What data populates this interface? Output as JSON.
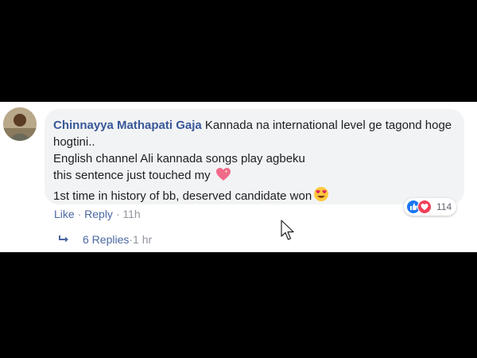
{
  "comment": {
    "author": "Chinnayya Mathapati Gaja",
    "lines": [
      "Kannada na international level ge tagond hoge hogtini..",
      "English channel Ali kannada songs play agbeku",
      "this sentence just touched my",
      "1st time in history of bb, deserved candidate won"
    ],
    "emoji_line3": "sparkling-heart-icon",
    "emoji_line4": "heart-eyes-emoji-icon"
  },
  "reactions": {
    "icons": [
      "like-icon",
      "love-icon"
    ],
    "count": "114"
  },
  "actions": {
    "like": "Like",
    "sep1": " · ",
    "reply": "Reply",
    "sep2": " · ",
    "time": "11h"
  },
  "replies": {
    "label": "6 Replies",
    "sep": " · ",
    "time": "1 hr"
  },
  "colors": {
    "author": "#385898",
    "link": "#4b67a1",
    "meta": "#90949c",
    "bubble": "#f2f3f5",
    "like": "#1877f2",
    "love": "#f33e58"
  }
}
